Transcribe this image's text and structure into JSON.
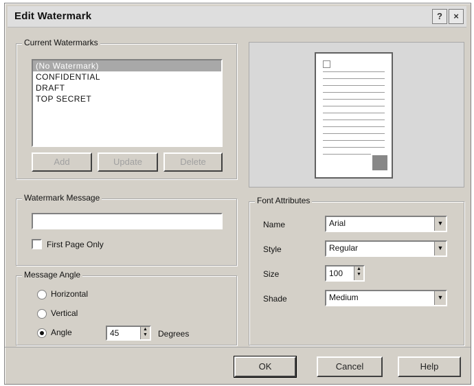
{
  "window": {
    "title": "Edit Watermark",
    "help_glyph": "?",
    "close_glyph": "×"
  },
  "current_watermarks": {
    "label": "Current Watermarks",
    "items": [
      "(No Watermark)",
      "CONFIDENTIAL",
      "DRAFT",
      "TOP SECRET"
    ],
    "selected_index": 0,
    "buttons": [
      "Add",
      "Update",
      "Delete"
    ]
  },
  "watermark_message": {
    "label": "Watermark Message",
    "value": "",
    "first_page_label": "First Page Only",
    "first_page_checked": false
  },
  "message_angle": {
    "label": "Message Angle",
    "options": [
      "Horizontal",
      "Vertical",
      "Angle"
    ],
    "selected": "Angle",
    "angle_value": "45",
    "degrees_label": "Degrees"
  },
  "font_attributes": {
    "label": "Font Attributes",
    "name_label": "Name",
    "name_value": "Arial",
    "style_label": "Style",
    "style_value": "Regular",
    "size_label": "Size",
    "size_value": "100",
    "shade_label": "Shade",
    "shade_value": "Medium"
  },
  "footer": {
    "ok": "OK",
    "cancel": "Cancel",
    "help": "Help"
  },
  "icons": {
    "dropdown": "▼",
    "spin_up": "▲",
    "spin_down": "▼"
  },
  "colors": {
    "dialog_bg": "#d4d0c8",
    "selection": "#a8a8a8"
  }
}
